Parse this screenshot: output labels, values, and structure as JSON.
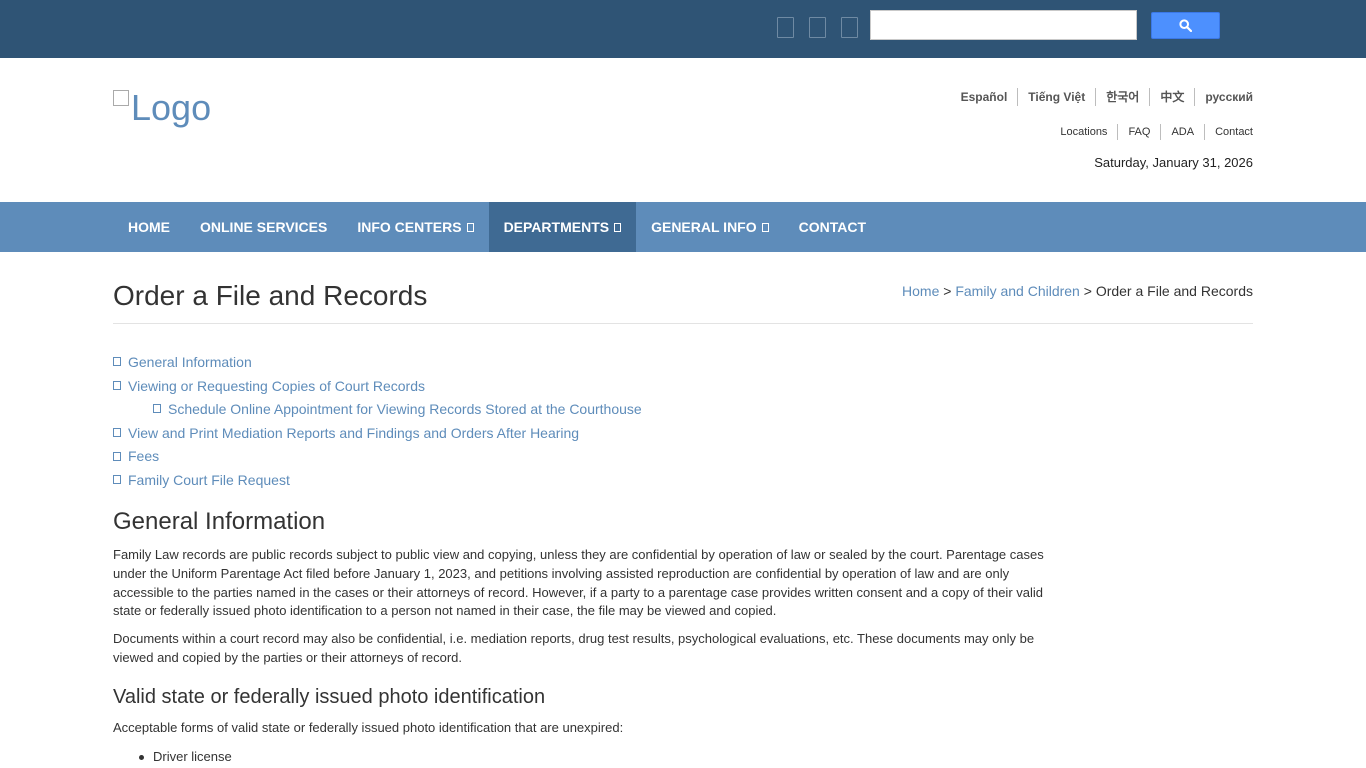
{
  "top_bar": {
    "social_icons": [
      "facebook-icon",
      "twitter-icon",
      "youtube-icon"
    ],
    "search": {
      "placeholder": "",
      "button_icon": "search-icon"
    },
    "colors": {
      "background": "#2f5475",
      "search_button": "#4d90fe"
    }
  },
  "header": {
    "logo_alt": "Logo",
    "languages": [
      "Español",
      "Tiếng Việt",
      "한국어",
      "中文",
      "русский"
    ],
    "utility_links": [
      "Locations",
      "FAQ",
      "ADA",
      "Contact"
    ],
    "date": "Saturday, January 31, 2026"
  },
  "nav": {
    "colors": {
      "background": "#5e8cba",
      "active": "#3f6a93"
    },
    "items": [
      {
        "label": "HOME",
        "has_dropdown": false
      },
      {
        "label": "ONLINE SERVICES",
        "has_dropdown": false
      },
      {
        "label": "INFO CENTERS",
        "has_dropdown": true
      },
      {
        "label": "DEPARTMENTS",
        "has_dropdown": true,
        "active": true
      },
      {
        "label": "GENERAL INFO",
        "has_dropdown": true
      },
      {
        "label": "CONTACT",
        "has_dropdown": false
      }
    ]
  },
  "page": {
    "title": "Order a File and Records",
    "breadcrumb": {
      "home": "Home",
      "sep1": ">",
      "parent": "Family and Children",
      "sep2": ">",
      "current": "Order a File and Records"
    }
  },
  "toc": [
    {
      "label": "General Information",
      "level": 1
    },
    {
      "label": "Viewing or Requesting Copies of Court Records",
      "level": 1
    },
    {
      "label": "Schedule Online Appointment for Viewing Records Stored at the Courthouse",
      "level": 2
    },
    {
      "label": "View and Print Mediation Reports and Findings and Orders After Hearing",
      "level": 1
    },
    {
      "label": "Fees",
      "level": 1
    },
    {
      "label": "Family Court File Request",
      "level": 1
    }
  ],
  "content": {
    "general_heading": "General Information",
    "para1": "Family Law records are public records subject to public view and copying, unless they are confidential by operation of law or sealed by the court. Parentage cases under the Uniform Parentage Act filed before January 1, 2023, and petitions involving assisted reproduction are confidential by operation of law and are only accessible to the parties named in the cases or their attorneys of record. However, if a party to a parentage case provides written consent and a copy of their valid state or federally issued photo identification to a person not named in their case, the file may be viewed and copied.",
    "para2": "Documents within a court record may also be confidential, i.e. mediation reports, drug test results, psychological evaluations, etc. These documents may only be viewed and copied by the parties or their attorneys of record.",
    "id_heading": "Valid state or federally issued photo identification",
    "id_intro": "Acceptable forms of valid state or federally issued photo identification that are unexpired:",
    "id_list": [
      "Driver license"
    ]
  }
}
